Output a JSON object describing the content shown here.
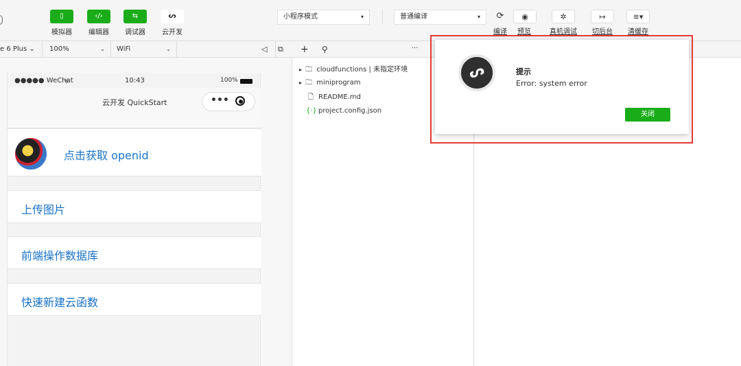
{
  "toolbar": {
    "simulator_label": "模拟器",
    "editor_label": "编辑器",
    "debugger_label": "调试器",
    "cloud_label": "云开发",
    "mode_select": "小程序模式",
    "compile_select": "普通编译",
    "compile_label": "编译",
    "preview_label": "预览",
    "realdevice_label": "真机调试",
    "background_label": "切后台",
    "clearcache_label": "清缓存"
  },
  "subbar": {
    "device": "e 6 Plus",
    "zoom": "100%",
    "network": "WiFi"
  },
  "simulator": {
    "status_carrier": "●●●●● WeChat",
    "status_time": "10:43",
    "status_battery": "100%",
    "nav_title": "云开发 QuickStart",
    "openid_label": "点击获取 openid",
    "upload_label": "上传图片",
    "db_label": "前端操作数据库",
    "cloudfn_label": "快速新建云函数"
  },
  "files": [
    {
      "name": "cloudfunctions | 未指定环境",
      "icon": "cloud-folder-icon",
      "arrow": "▸"
    },
    {
      "name": "miniprogram",
      "icon": "folder-icon",
      "arrow": "▸"
    },
    {
      "name": "README.md",
      "icon": "file-icon",
      "arrow": ""
    },
    {
      "name": "project.config.json",
      "icon": "json-icon",
      "arrow": ""
    }
  ],
  "dialog": {
    "title": "提示",
    "message": "Error: system error",
    "close_label": "关闭"
  },
  "colors": {
    "accent": "#1aad19",
    "link": "#1a73c8",
    "highlight": "#e53935"
  }
}
